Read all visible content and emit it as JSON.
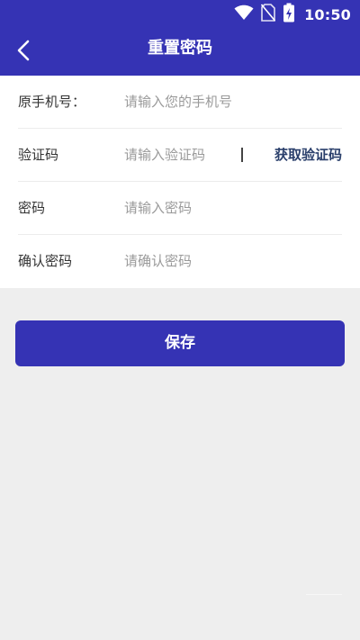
{
  "status_bar": {
    "time": "10:50"
  },
  "header": {
    "title": "重置密码"
  },
  "form": {
    "rows": [
      {
        "label": "原手机号：",
        "placeholder": "请输入您的手机号"
      },
      {
        "label": "验证码",
        "placeholder": "请输入验证码",
        "action_label": "获取验证码"
      },
      {
        "label": "密码",
        "placeholder": "请输入密码"
      },
      {
        "label": "确认密码",
        "placeholder": "请确认密码"
      }
    ]
  },
  "save_button": {
    "label": "保存"
  },
  "colors": {
    "primary": "#3533b4",
    "background": "#eeeeee",
    "card": "#ffffff",
    "label_text": "#333333",
    "placeholder_text": "#9a9a9a",
    "action_text": "#2a3f6b"
  }
}
